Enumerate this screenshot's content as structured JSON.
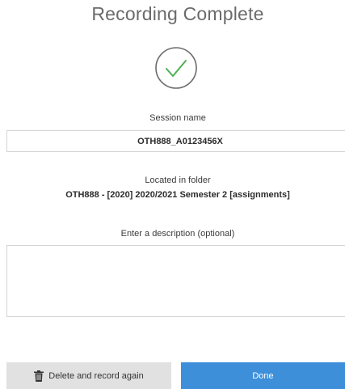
{
  "header": {
    "title": "Recording Complete"
  },
  "status": {
    "icon": "check-circle-icon",
    "color": "#4caf50"
  },
  "session": {
    "label": "Session name",
    "value": "OTH888_A0123456X"
  },
  "folder": {
    "label": "Located in folder",
    "value": "OTH888 - [2020] 2020/2021 Semester 2 [assignments]"
  },
  "description": {
    "label": "Enter a description (optional)",
    "value": ""
  },
  "actions": {
    "delete_label": "Delete and record again",
    "delete_icon": "trash-icon",
    "done_label": "Done",
    "done_color": "#3d8fd9"
  }
}
